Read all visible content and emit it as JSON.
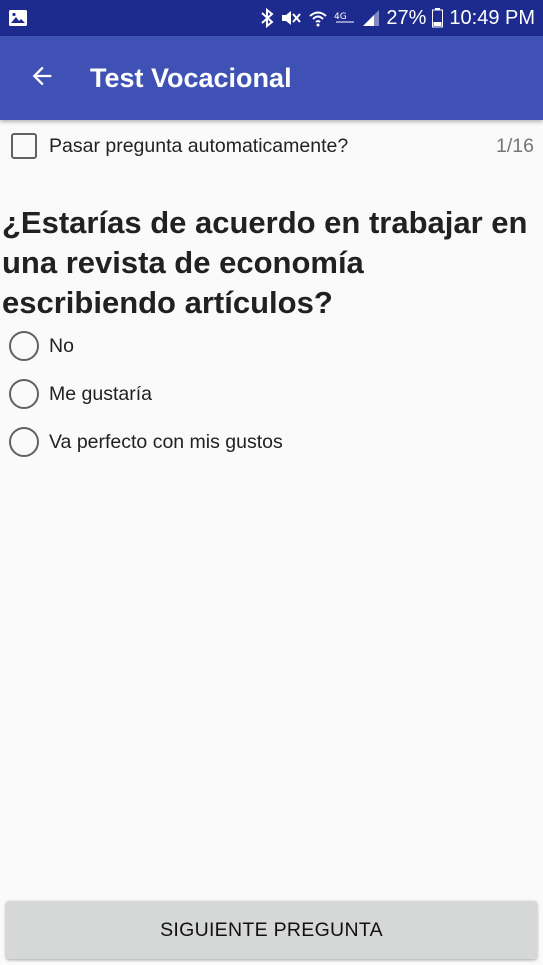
{
  "status_bar": {
    "battery": "27%",
    "time": "10:49 PM",
    "icons": [
      "image-icon",
      "bluetooth-icon",
      "mute-icon",
      "wifi-icon",
      "lte-icon",
      "signal-icon",
      "battery-icon"
    ]
  },
  "app_bar": {
    "title": "Test Vocacional",
    "back_icon": "arrow-back-icon"
  },
  "auto_advance": {
    "label": "Pasar pregunta automaticamente?",
    "checked": false
  },
  "counter": "1/16",
  "question": "¿Estarías de acuerdo en trabajar en una revista de economía escribiendo artículos?",
  "options": [
    {
      "label": "No",
      "selected": false
    },
    {
      "label": "Me gustaría",
      "selected": false
    },
    {
      "label": "Va perfecto con mis gustos",
      "selected": false
    }
  ],
  "next_button": {
    "label": "SIGUIENTE PREGUNTA"
  },
  "colors": {
    "status_bar": "#1d2b8f",
    "app_bar": "#3f51b5",
    "background": "#fafafa",
    "button": "#d6d7d7"
  }
}
